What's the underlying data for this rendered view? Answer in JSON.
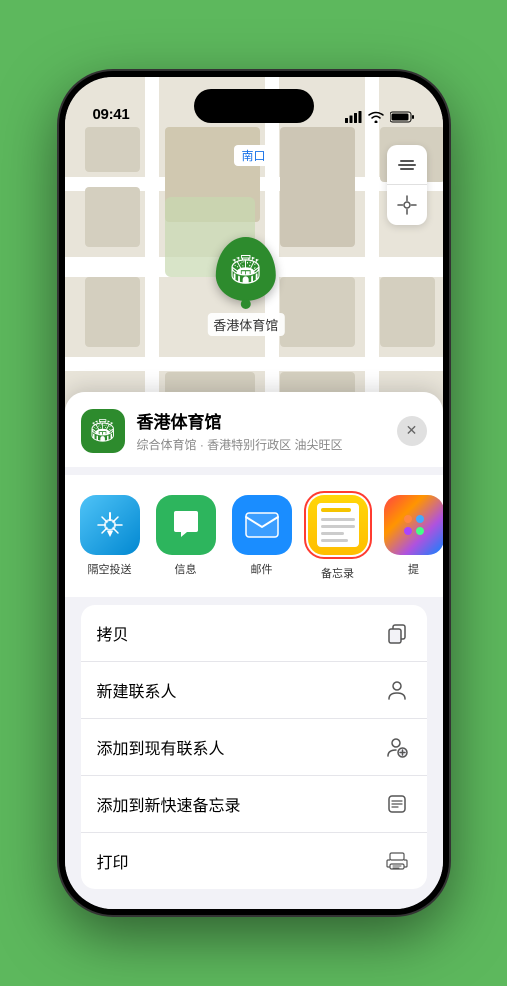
{
  "status_bar": {
    "time": "09:41",
    "signal_bars": "▐▐▐▐",
    "wifi": "wifi",
    "battery": "battery"
  },
  "map": {
    "label": "南口",
    "marker_label": "香港体育馆"
  },
  "venue": {
    "name": "香港体育馆",
    "subtitle": "综合体育馆 · 香港特别行政区 油尖旺区",
    "icon": "🏟"
  },
  "share_apps": [
    {
      "id": "airdrop",
      "label": "隔空投送",
      "type": "airdrop"
    },
    {
      "id": "messages",
      "label": "信息",
      "type": "messages"
    },
    {
      "id": "mail",
      "label": "邮件",
      "type": "mail"
    },
    {
      "id": "notes",
      "label": "备忘录",
      "type": "notes",
      "highlighted": true
    },
    {
      "id": "more",
      "label": "提",
      "type": "more"
    }
  ],
  "actions": [
    {
      "id": "copy",
      "label": "拷贝",
      "icon": "copy"
    },
    {
      "id": "new-contact",
      "label": "新建联系人",
      "icon": "person"
    },
    {
      "id": "add-existing",
      "label": "添加到现有联系人",
      "icon": "person-add"
    },
    {
      "id": "add-note",
      "label": "添加到新快速备忘录",
      "icon": "note"
    },
    {
      "id": "print",
      "label": "打印",
      "icon": "print"
    }
  ]
}
